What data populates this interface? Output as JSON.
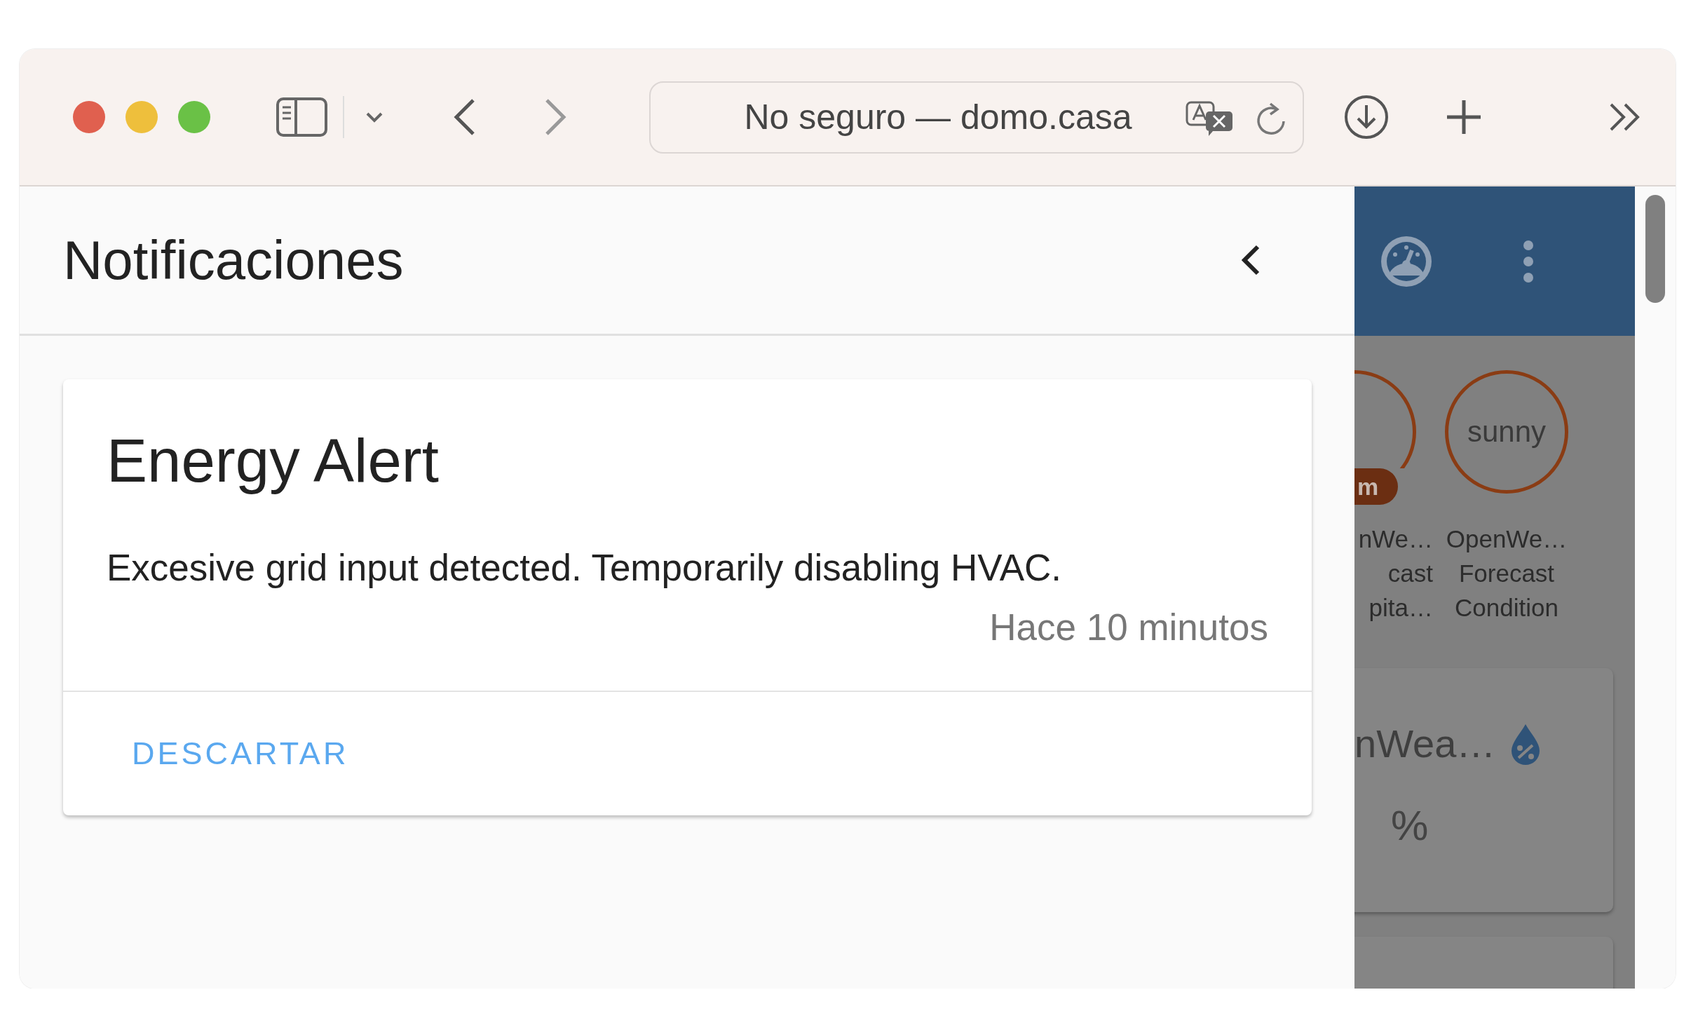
{
  "browser": {
    "address": "No seguro — domo.casa"
  },
  "drawer": {
    "title": "Notificaciones"
  },
  "notifications": [
    {
      "title": "Energy Alert",
      "message": "Excesive grid input detected. Temporarily disabling HVAC.",
      "time": "Hace 10 minutos",
      "action": "DESCARTAR"
    }
  ],
  "dashboard": {
    "badges": [
      {
        "unit": "m",
        "label_lines": [
          "nWe…",
          "cast",
          "pita…"
        ]
      },
      {
        "value": "sunny",
        "label_lines": [
          "OpenWe…",
          "Forecast",
          "Condition"
        ]
      }
    ],
    "cards": [
      {
        "title": "nWea…",
        "unit": "%"
      }
    ]
  }
}
